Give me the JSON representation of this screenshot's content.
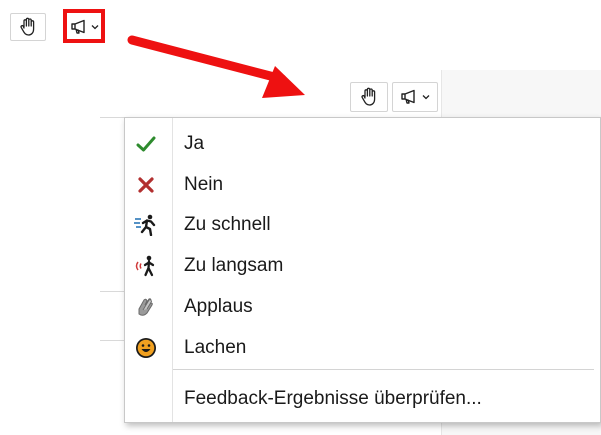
{
  "toolbar_top": {
    "raise_hand_icon": "hand-icon",
    "feedback_icon": "megaphone-icon",
    "dropdown_icon": "chevron-down-icon"
  },
  "toolbar_secondary": {
    "raise_hand_icon": "hand-icon",
    "feedback_icon": "megaphone-icon",
    "dropdown_icon": "chevron-down-icon"
  },
  "annotation": {
    "highlight_color": "#ee1111",
    "arrow_color": "#ee1111"
  },
  "menu": {
    "items": [
      {
        "label": "Ja",
        "icon": "check-icon",
        "color": "#2e8b2e"
      },
      {
        "label": "Nein",
        "icon": "x-icon",
        "color": "#b23030"
      },
      {
        "label": "Zu schnell",
        "icon": "running-figure-icon",
        "color": "#1f6fb2"
      },
      {
        "label": "Zu langsam",
        "icon": "walking-figure-icon",
        "color": "#1a1a1a"
      },
      {
        "label": "Applaus",
        "icon": "clapping-hands-icon",
        "color": "#8a8a8a"
      },
      {
        "label": "Lachen",
        "icon": "smiley-icon",
        "color": "#f0a020"
      }
    ],
    "footer_label": "Feedback-Ergebnisse überprüfen..."
  }
}
